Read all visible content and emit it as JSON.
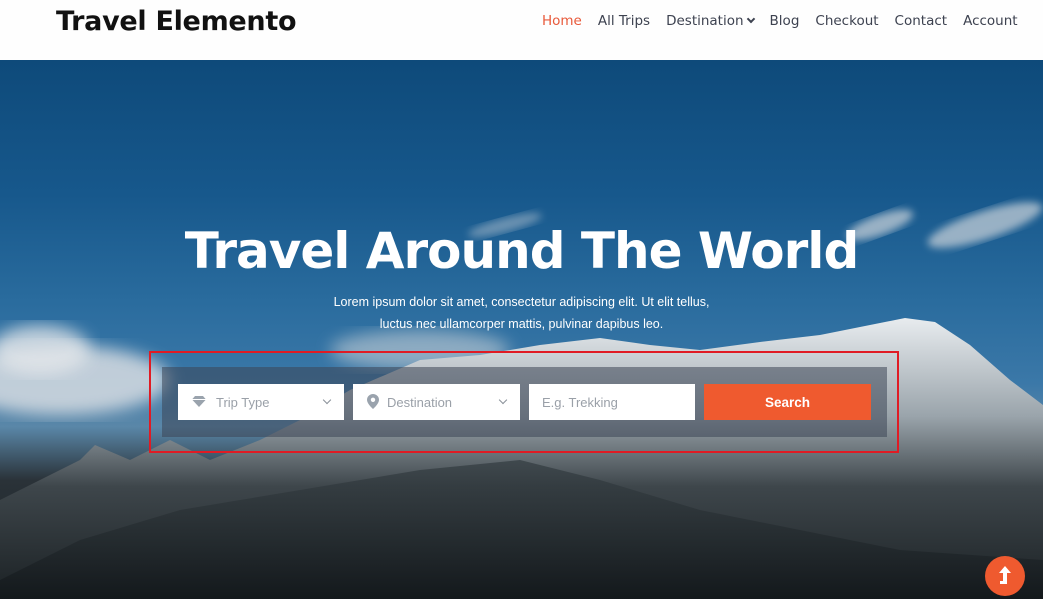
{
  "header": {
    "logo": "Travel Elemento",
    "nav": [
      {
        "label": "Home",
        "active": true
      },
      {
        "label": "All Trips"
      },
      {
        "label": "Destination",
        "has_dropdown": true
      },
      {
        "label": "Blog"
      },
      {
        "label": "Checkout"
      },
      {
        "label": "Contact"
      },
      {
        "label": "Account"
      }
    ]
  },
  "hero": {
    "title": "Travel Around The World",
    "subtitle_line1": "Lorem ipsum dolor sit amet, consectetur adipiscing elit. Ut elit tellus,",
    "subtitle_line2": "luctus nec ullamcorper mattis, pulvinar dapibus leo."
  },
  "search": {
    "trip_type": {
      "placeholder": "Trip Type",
      "icon": "diamond-icon"
    },
    "destination": {
      "placeholder": "Destination",
      "icon": "map-pin-icon"
    },
    "keyword": {
      "placeholder": "E.g. Trekking"
    },
    "button": "Search"
  },
  "colors": {
    "accent": "#ef5a2f",
    "nav_active": "#e8593a",
    "highlight_border": "#e01b24"
  },
  "scroll_top": {
    "icon": "arrow-up-icon"
  }
}
